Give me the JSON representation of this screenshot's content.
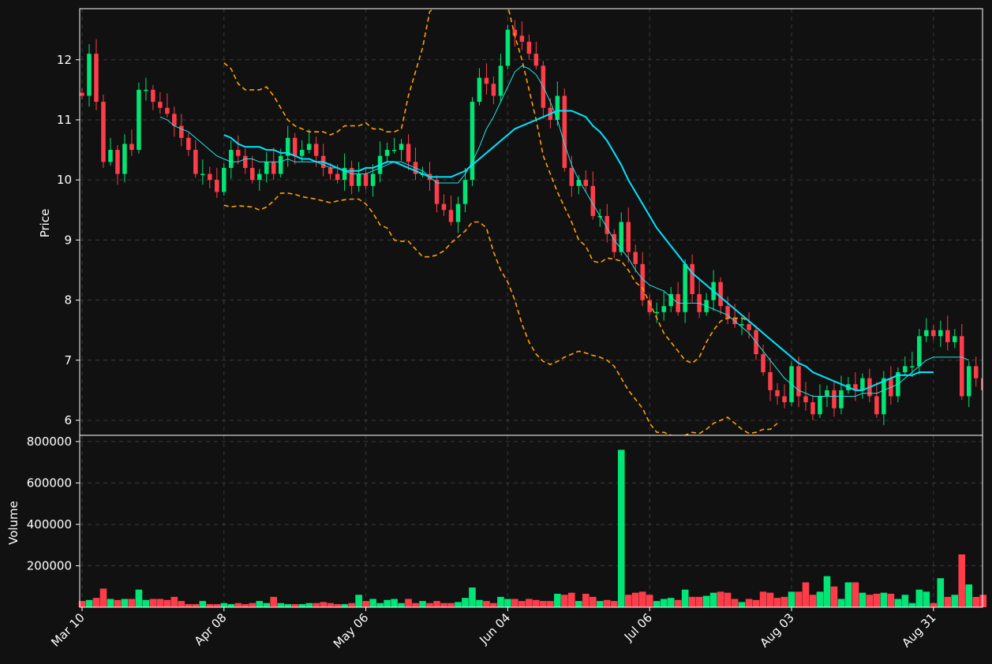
{
  "chart_data": {
    "type": "candlestick",
    "title": "",
    "colors": {
      "background": "#111111",
      "up": "#00e676",
      "down": "#ff3d4a",
      "ma_fast": "#1de9e9",
      "ma_slow": "#00e5ff",
      "band": "#ffa000",
      "grid": "#3a3a3a",
      "axis": "#ffffff"
    },
    "price_panel": {
      "ylabel": "Price",
      "ylim": [
        5.75,
        12.85
      ],
      "yticks": [
        6,
        7,
        8,
        9,
        10,
        11,
        12
      ]
    },
    "volume_panel": {
      "ylabel": "Volume",
      "ylim": [
        0,
        830000
      ],
      "yticks": [
        200000,
        400000,
        600000,
        800000
      ],
      "ytick_labels": [
        "200000",
        "400000",
        "600000",
        "800000"
      ]
    },
    "x_ticks": [
      {
        "label": "Mar 10",
        "index": 0
      },
      {
        "label": "Apr 08",
        "index": 20
      },
      {
        "label": "May 06",
        "index": 40
      },
      {
        "label": "Jun 04",
        "index": 60
      },
      {
        "label": "Jul 06",
        "index": 80
      },
      {
        "label": "Aug 03",
        "index": 100
      },
      {
        "label": "Aug 31",
        "index": 120
      }
    ],
    "closes": [
      11.4,
      12.1,
      11.3,
      10.3,
      10.5,
      10.1,
      10.6,
      10.5,
      11.5,
      11.5,
      11.3,
      11.2,
      11.1,
      10.9,
      10.7,
      10.5,
      10.1,
      10.1,
      10.0,
      9.8,
      10.2,
      10.5,
      10.4,
      10.2,
      10.0,
      10.1,
      10.3,
      10.1,
      10.4,
      10.7,
      10.4,
      10.5,
      10.6,
      10.4,
      10.2,
      10.1,
      10.0,
      10.2,
      9.9,
      10.1,
      9.9,
      10.1,
      10.4,
      10.5,
      10.5,
      10.6,
      10.3,
      10.1,
      10.1,
      10.0,
      9.6,
      9.5,
      9.3,
      9.6,
      10.0,
      11.3,
      11.7,
      11.6,
      11.4,
      11.9,
      12.5,
      12.4,
      12.3,
      12.1,
      11.9,
      11.2,
      11.0,
      11.4,
      10.2,
      9.9,
      10.0,
      9.9,
      9.4,
      9.4,
      9.1,
      8.8,
      9.3,
      8.8,
      8.6,
      8.0,
      7.8,
      7.8,
      7.9,
      8.1,
      7.8,
      8.6,
      8.1,
      7.8,
      8.0,
      8.3,
      7.9,
      7.7,
      7.6,
      7.6,
      7.5,
      7.1,
      6.8,
      6.5,
      6.4,
      6.3,
      6.9,
      6.4,
      6.3,
      6.1,
      6.4,
      6.5,
      6.2,
      6.5,
      6.6,
      6.5,
      6.7,
      6.4,
      6.1,
      6.7,
      6.4,
      6.8,
      6.9,
      6.9,
      7.4,
      7.5,
      7.4,
      7.5,
      7.3,
      7.4,
      6.4,
      6.9,
      6.7,
      6.5
    ],
    "ma_fast": [
      null,
      null,
      null,
      null,
      null,
      null,
      null,
      null,
      null,
      null,
      null,
      11.05,
      11.0,
      10.9,
      10.85,
      10.8,
      10.7,
      10.6,
      10.5,
      10.4,
      10.35,
      10.3,
      10.3,
      10.35,
      10.35,
      10.3,
      10.3,
      10.3,
      10.3,
      10.35,
      10.3,
      10.3,
      10.3,
      10.3,
      10.25,
      10.2,
      10.2,
      10.15,
      10.1,
      10.1,
      10.1,
      10.15,
      10.2,
      10.25,
      10.3,
      10.3,
      10.25,
      10.2,
      10.15,
      10.05,
      9.95,
      9.95,
      9.95,
      9.95,
      10.1,
      10.3,
      10.55,
      10.85,
      11.05,
      11.3,
      11.55,
      11.8,
      11.9,
      11.85,
      11.75,
      11.55,
      11.3,
      11.0,
      10.6,
      10.25,
      10.0,
      9.8,
      9.6,
      9.4,
      9.2,
      9.0,
      8.85,
      8.7,
      8.5,
      8.35,
      8.25,
      8.2,
      8.15,
      8.05,
      7.95,
      7.95,
      7.95,
      7.95,
      7.9,
      7.85,
      7.8,
      7.75,
      7.65,
      7.55,
      7.45,
      7.3,
      7.15,
      7.0,
      6.85,
      6.7,
      6.6,
      6.5,
      6.45,
      6.4,
      6.4,
      6.4,
      6.4,
      6.4,
      6.4,
      6.4,
      6.45,
      6.45,
      6.45,
      6.5,
      6.55,
      6.6,
      6.7,
      6.8,
      6.9,
      7.0,
      7.05,
      7.05,
      7.05,
      7.05,
      7.05,
      7.0
    ],
    "ma_slow": [
      null,
      null,
      null,
      null,
      null,
      null,
      null,
      null,
      null,
      null,
      null,
      null,
      null,
      null,
      null,
      null,
      null,
      null,
      null,
      null,
      10.75,
      10.7,
      10.6,
      10.55,
      10.55,
      10.55,
      10.5,
      10.5,
      10.45,
      10.45,
      10.4,
      10.35,
      10.35,
      10.3,
      10.3,
      10.25,
      10.2,
      10.15,
      10.15,
      10.15,
      10.2,
      10.2,
      10.25,
      10.3,
      10.3,
      10.25,
      10.2,
      10.15,
      10.1,
      10.05,
      10.05,
      10.05,
      10.05,
      10.1,
      10.15,
      10.25,
      10.35,
      10.45,
      10.55,
      10.65,
      10.75,
      10.85,
      10.9,
      10.95,
      11.0,
      11.05,
      11.1,
      11.15,
      11.15,
      11.15,
      11.1,
      11.05,
      10.9,
      10.8,
      10.65,
      10.45,
      10.25,
      10.0,
      9.8,
      9.6,
      9.4,
      9.2,
      9.05,
      8.9,
      8.75,
      8.6,
      8.45,
      8.35,
      8.25,
      8.15,
      8.05,
      7.95,
      7.85,
      7.75,
      7.65,
      7.55,
      7.45,
      7.35,
      7.25,
      7.15,
      7.05,
      6.95,
      6.9,
      6.8,
      6.75,
      6.7,
      6.65,
      6.6,
      6.55,
      6.5,
      6.5,
      6.55,
      6.6,
      6.65,
      6.7,
      6.75,
      6.75,
      6.75,
      6.8,
      6.8,
      6.8
    ],
    "band_upper": [
      null,
      null,
      null,
      null,
      null,
      null,
      null,
      null,
      null,
      null,
      null,
      null,
      null,
      null,
      null,
      null,
      null,
      null,
      null,
      null,
      11.95,
      11.85,
      11.6,
      11.5,
      11.5,
      11.5,
      11.55,
      11.4,
      11.2,
      11.0,
      10.9,
      10.85,
      10.8,
      10.8,
      10.8,
      10.75,
      10.8,
      10.9,
      10.9,
      10.9,
      10.95,
      10.85,
      10.85,
      10.8,
      10.8,
      10.85,
      11.4,
      11.8,
      12.2,
      12.8,
      12.9,
      12.9,
      12.9,
      12.9,
      12.9,
      12.9,
      12.9,
      12.9,
      12.9,
      12.9,
      12.9,
      12.4,
      12.0,
      11.5,
      11.0,
      10.4,
      10.1,
      9.8,
      9.55,
      9.3,
      9.0,
      8.9,
      8.65,
      8.62,
      8.7,
      8.68,
      8.65,
      8.5,
      8.3,
      8.2,
      7.95,
      7.7,
      7.45,
      7.3,
      7.15,
      7.0,
      6.95,
      7.05,
      7.3,
      7.5,
      7.65,
      7.7,
      7.7,
      7.7,
      7.65
    ],
    "band_lower": [
      null,
      null,
      null,
      null,
      null,
      null,
      null,
      null,
      null,
      null,
      null,
      null,
      null,
      null,
      null,
      null,
      null,
      null,
      null,
      null,
      9.58,
      9.55,
      9.57,
      9.56,
      9.55,
      9.5,
      9.55,
      9.65,
      9.78,
      9.78,
      9.76,
      9.72,
      9.7,
      9.68,
      9.65,
      9.62,
      9.65,
      9.67,
      9.68,
      9.68,
      9.6,
      9.45,
      9.25,
      9.2,
      9.0,
      8.98,
      8.98,
      8.85,
      8.72,
      8.72,
      8.75,
      8.82,
      8.95,
      9.05,
      9.15,
      9.3,
      9.3,
      9.2,
      8.8,
      8.5,
      8.3,
      8.0,
      7.6,
      7.3,
      7.1,
      6.98,
      6.93,
      6.98,
      7.05,
      7.1,
      7.15,
      7.12,
      7.08,
      7.05,
      7.0,
      6.9,
      6.7,
      6.5,
      6.35,
      6.2,
      5.95,
      5.8,
      5.8,
      5.75,
      5.7,
      5.75,
      5.8,
      5.78,
      5.85,
      5.95,
      6.0,
      6.05,
      5.95,
      5.85,
      5.78,
      5.8,
      5.85,
      5.85,
      5.95
    ],
    "volumes": [
      30000,
      35000,
      45000,
      90000,
      40000,
      35000,
      40000,
      40000,
      85000,
      35000,
      40000,
      40000,
      35000,
      50000,
      30000,
      15000,
      15000,
      30000,
      15000,
      15000,
      20000,
      15000,
      20000,
      15000,
      20000,
      30000,
      20000,
      50000,
      20000,
      15000,
      15000,
      15000,
      20000,
      20000,
      25000,
      20000,
      15000,
      15000,
      20000,
      60000,
      30000,
      40000,
      20000,
      35000,
      40000,
      20000,
      40000,
      20000,
      30000,
      20000,
      30000,
      20000,
      20000,
      25000,
      45000,
      95000,
      35000,
      30000,
      20000,
      50000,
      40000,
      40000,
      30000,
      40000,
      35000,
      30000,
      30000,
      65000,
      60000,
      70000,
      30000,
      65000,
      50000,
      30000,
      35000,
      30000,
      760000,
      60000,
      70000,
      75000,
      60000,
      30000,
      40000,
      45000,
      35000,
      85000,
      50000,
      50000,
      55000,
      70000,
      75000,
      70000,
      40000,
      25000,
      40000,
      35000,
      75000,
      70000,
      45000,
      50000,
      75000,
      75000,
      120000,
      60000,
      75000,
      150000,
      100000,
      40000,
      120000,
      120000,
      70000,
      60000,
      65000,
      70000,
      65000,
      40000,
      60000,
      20000,
      85000,
      75000,
      20000,
      140000,
      50000,
      60000,
      255000,
      110000,
      50000,
      60000
    ]
  }
}
